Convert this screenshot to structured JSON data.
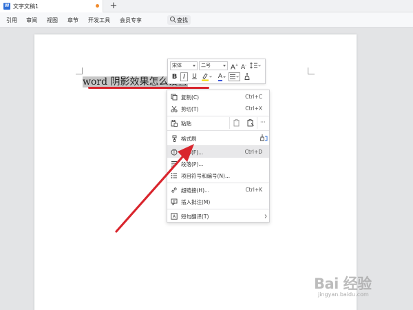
{
  "titlebar": {
    "doc_icon_letter": "W",
    "doc_tab_title": "文字文稿1",
    "new_tab": "+"
  },
  "ribbon": {
    "tabs": [
      "引用",
      "审阅",
      "视图",
      "章节",
      "开发工具",
      "会员专享"
    ],
    "search_label": "查找"
  },
  "document": {
    "text": "word 阴影效果怎么设置"
  },
  "mini_toolbar": {
    "font_name": "宋体",
    "font_size": "二号",
    "grow_font": "A",
    "shrink_font": "A",
    "bold": "B",
    "italic": "I",
    "underline": "U",
    "font_color": "A"
  },
  "context_menu": {
    "items": [
      {
        "label": "复制(C)",
        "shortcut": "Ctrl+C",
        "icon": "copy-icon"
      },
      {
        "label": "剪切(T)",
        "shortcut": "Ctrl+X",
        "icon": "scissors-icon"
      },
      {
        "label": "粘贴",
        "shortcut": "",
        "icon": "paste-icon"
      },
      {
        "label": "格式刷",
        "shortcut": "",
        "icon": "format-painter-icon"
      },
      {
        "label": "字体(F)...",
        "shortcut": "Ctrl+D",
        "icon": "font-icon"
      },
      {
        "label": "段落(P)...",
        "shortcut": "",
        "icon": "paragraph-icon"
      },
      {
        "label": "项目符号和编号(N)...",
        "shortcut": "",
        "icon": "bullets-numbering-icon"
      },
      {
        "label": "超链接(H)...",
        "shortcut": "Ctrl+K",
        "icon": "hyperlink-icon"
      },
      {
        "label": "插入批注(M)",
        "shortcut": "",
        "icon": "comment-icon"
      },
      {
        "label": "短句翻译(T)",
        "shortcut": "",
        "icon": "translate-icon"
      }
    ],
    "more": "···"
  },
  "colors": {
    "accent_blue": "#2e6fd8",
    "annotation_red": "#d9252d",
    "highlight": "#c6c6c6",
    "unsaved_dot": "#f08a2b"
  },
  "watermark": {
    "brand": "Bai 经验",
    "url": "jingyan.baidu.com"
  }
}
